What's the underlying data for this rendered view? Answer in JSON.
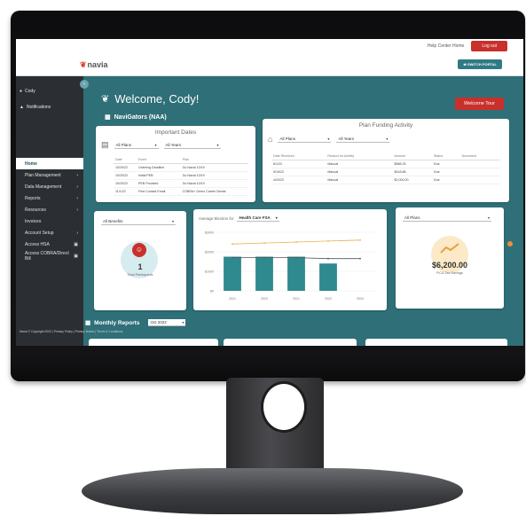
{
  "topbar": {
    "help": "Help Center Home",
    "logout": "Log out"
  },
  "brand": {
    "logo": "navia",
    "switch": "SWITCH PORTAL"
  },
  "sidebar": {
    "user": "Cody",
    "notifications": "Notifications",
    "items": [
      {
        "label": "Home"
      },
      {
        "label": "Plan Management"
      },
      {
        "label": "Data Management"
      },
      {
        "label": "Reports"
      },
      {
        "label": "Resources"
      },
      {
        "label": "Invoices"
      },
      {
        "label": "Account Setup"
      },
      {
        "label": "Access HSA"
      },
      {
        "label": "Access COBRA/Direct Bill"
      }
    ],
    "footer": "Navia © Copyright 2022 | Privacy Policy | Privacy Notice | Terms & Conditions"
  },
  "main": {
    "welcome": "Welcome, Cody!",
    "tour_button": "Welcome Tour",
    "group": "NaviGators (NAA)",
    "monthly_title": "Monthly Reports",
    "monthly_select": "Oct 2022"
  },
  "important_dates": {
    "title": "Important Dates",
    "plan_select": "All Plans",
    "year_select": "All Years",
    "columns": [
      "Date",
      "Event",
      "Plan"
    ],
    "rows": [
      [
        "10/20/22",
        "Ordering Deadline",
        "Go Naval 10/19"
      ],
      [
        "10/20/22",
        "Initial PEB",
        "Go Naval 10/19"
      ],
      [
        "10/20/22",
        "PEB Provided",
        "Go Naval 10/19"
      ],
      [
        "11/1/22",
        "First Contact Email",
        "COBRA+ Demo Carrier Dental"
      ]
    ]
  },
  "plan_funding": {
    "title": "Plan Funding Activity",
    "plan_select": "All Plans",
    "year_select": "All Years",
    "columns": [
      "Date Received",
      "Reason for Activity",
      "Amount",
      "Status",
      "Document"
    ],
    "rows": [
      [
        "6/1/22",
        "Manual",
        "$588.25",
        "Due",
        ""
      ],
      [
        "5/19/22",
        "Manual",
        "$418.86",
        "Due",
        ""
      ],
      [
        "4/20/22",
        "Manual",
        "$2,000.00",
        "Due",
        ""
      ]
    ]
  },
  "benefits_card": {
    "select": "All Benefits",
    "count": "1",
    "label": "Total Participants"
  },
  "election_card": {
    "label": "Average Election for",
    "select": "Health Care FSA"
  },
  "savings_card": {
    "select": "All Plans",
    "amount": "$6,200.00",
    "label": "FICA Tax Savings"
  },
  "chart_data": {
    "type": "bar",
    "categories": [
      "2021",
      "2022",
      "2021",
      "2022",
      "2020"
    ],
    "y_ticks": [
      "$3000",
      "$2000",
      "$1000",
      "$0"
    ],
    "ylim": [
      0,
      3000
    ],
    "series": [
      {
        "values": [
          1750,
          1750,
          1750,
          1400,
          null
        ]
      }
    ],
    "reference_lines": [
      {
        "values": [
          2400,
          2450,
          2500,
          2550,
          2600
        ],
        "color": "#e8b04b"
      },
      {
        "values": [
          1700,
          1700,
          1700,
          1650,
          1650
        ],
        "color": "#555555"
      }
    ],
    "bar_color": "#2f8a8f",
    "title": "",
    "xlabel": "",
    "ylabel": ""
  }
}
